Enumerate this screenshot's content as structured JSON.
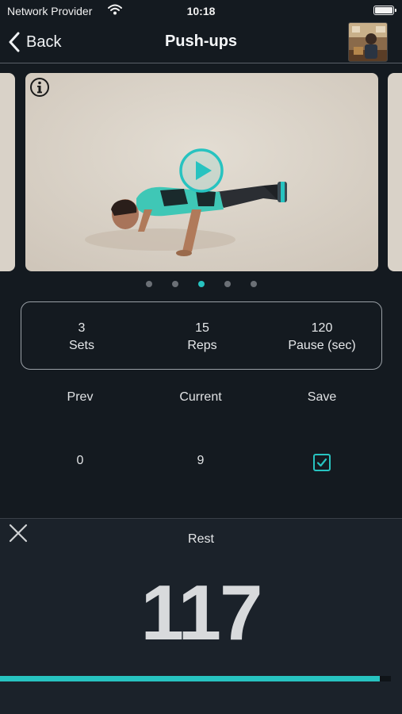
{
  "status_bar": {
    "carrier": "Network Provider",
    "time": "10:18",
    "wifi_icon": "wifi-icon",
    "battery_icon": "battery-icon"
  },
  "nav": {
    "back_label": "Back",
    "title": "Push-ups",
    "profile_image": "profile-avatar"
  },
  "carousel": {
    "page_count": 5,
    "active_page": 3,
    "info_icon": "info-icon",
    "play_icon": "play-icon"
  },
  "stats": {
    "sets": {
      "value": "3",
      "label": "Sets"
    },
    "reps": {
      "value": "15",
      "label": "Reps"
    },
    "pause": {
      "value": "120",
      "label": "Pause (sec)"
    }
  },
  "table": {
    "headers": [
      "Prev",
      "Current",
      "Save"
    ],
    "row": {
      "prev": "0",
      "current": "9",
      "save_checked": true
    }
  },
  "rest": {
    "label": "Rest",
    "countdown": "117",
    "progress": 0.972
  },
  "colors": {
    "accent": "#27c3c0",
    "background": "#141a20",
    "panel": "#1b222a"
  }
}
